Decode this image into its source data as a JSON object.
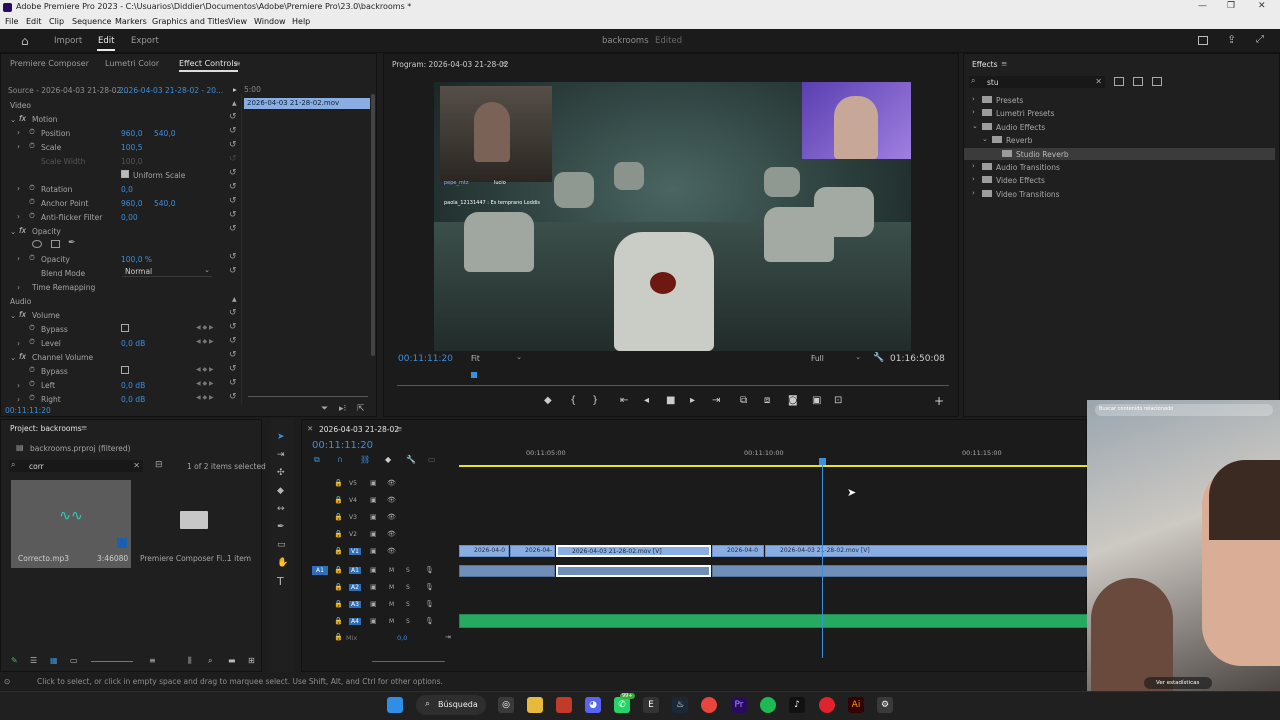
{
  "window": {
    "title": "Adobe Premiere Pro 2023 - C:\\Usuarios\\Diddier\\Documentos\\Adobe\\Premiere Pro\\23.0\\backrooms *",
    "minimize": "—",
    "restore": "❐",
    "close": "✕"
  },
  "menu": [
    "File",
    "Edit",
    "Clip",
    "Sequence",
    "Markers",
    "Graphics and Titles",
    "View",
    "Window",
    "Help"
  ],
  "workspace": {
    "tabs": [
      "Import",
      "Edit",
      "Export"
    ],
    "active": "Edit",
    "project_name": "backrooms",
    "status": "Edited"
  },
  "effect_panel": {
    "tabs": [
      "Premiere Composer",
      "Lumetri Color",
      "Effect Controls"
    ],
    "active_tab": "Effect Controls",
    "source": "Source - 2026-04-03 21-28-02...",
    "clip_select": "2026-04-03 21-28-02 - 20...",
    "timecode_ruler": "5:00",
    "clip_bar": "2026-04-03 21-28-02.mov",
    "video_header": "Video",
    "audio_header": "Audio",
    "motion": {
      "name": "Motion",
      "position_label": "Position",
      "position_x": "960,0",
      "position_y": "540,0",
      "scale_label": "Scale",
      "scale": "100,5",
      "scale_width_label": "Scale Width",
      "scale_width": "100,0",
      "uniform_label": "Uniform Scale",
      "rotation_label": "Rotation",
      "rotation": "0,0",
      "anchor_label": "Anchor Point",
      "anchor_x": "960,0",
      "anchor_y": "540,0",
      "flicker_label": "Anti-flicker Filter",
      "flicker": "0,00"
    },
    "opacity": {
      "name": "Opacity",
      "opacity_label": "Opacity",
      "opacity": "100,0 %",
      "blend_label": "Blend Mode",
      "blend": "Normal"
    },
    "time_remap": "Time Remapping",
    "volume": {
      "name": "Volume",
      "bypass_label": "Bypass",
      "level_label": "Level",
      "level": "0,0 dB"
    },
    "channel": {
      "name": "Channel Volume",
      "bypass_label": "Bypass",
      "left_label": "Left",
      "left": "0,0 dB",
      "right_label": "Right",
      "right": "0,0 dB"
    },
    "footer_tc": "00:11:11:20"
  },
  "program": {
    "title": "Program: 2026-04-03 21-28-02",
    "timecode": "00:11:11:20",
    "fit": "Fit",
    "quality": "Full",
    "duration": "01:16:50:08",
    "webcam_lines": [
      "pepe_mtz",
      "lucio",
      "paola_12131447 : Es temprano Loddis"
    ]
  },
  "effects": {
    "title": "Effects",
    "search": "stu",
    "tree": [
      {
        "label": "Presets",
        "level": 0
      },
      {
        "label": "Lumetri Presets",
        "level": 0
      },
      {
        "label": "Audio Effects",
        "level": 0
      },
      {
        "label": "Reverb",
        "level": 1
      },
      {
        "label": "Studio Reverb",
        "level": 2
      },
      {
        "label": "Audio Transitions",
        "level": 0
      },
      {
        "label": "Video Effects",
        "level": 0
      },
      {
        "label": "Video Transitions",
        "level": 0
      }
    ]
  },
  "project": {
    "title": "Project: backrooms",
    "file": "backrooms.prproj (filtered)",
    "search": "corr",
    "selected": "1 of 2 items selected",
    "items": [
      {
        "name": "Correcto.mp3",
        "meta": "3:46080"
      },
      {
        "name": "Premiere Composer Fi...",
        "meta": "1 item"
      }
    ]
  },
  "timeline": {
    "seq_name": "2026-04-03 21-28-02",
    "timecode": "00:11:11:20",
    "ruler": [
      "00:11:05:00",
      "00:11:10:00",
      "00:11:15:00"
    ],
    "video_tracks": [
      "V5",
      "V4",
      "V3",
      "V2",
      "V1"
    ],
    "audio_tracks": [
      "A1",
      "A2",
      "A3",
      "A4"
    ],
    "src_v": "V1",
    "src_a": "A1",
    "mix_label": "Mix",
    "mix_val": "0,0",
    "clips": [
      "2026-04-0",
      "2026-04-",
      "2026-04-03 21-28-02.mov [V]",
      "2026-04-0",
      "2026-04-03 21-28-02.mov [V]"
    ]
  },
  "status": "Click to select, or click in empty space and drag to marquee select. Use Shift, Alt, and Ctrl for other options.",
  "overlay": {
    "search_prompt": "Buscar contenido relacionado",
    "stats": "Ver estadísticas"
  },
  "taskbar": {
    "search": "Búsqueda",
    "badge": "99+"
  }
}
